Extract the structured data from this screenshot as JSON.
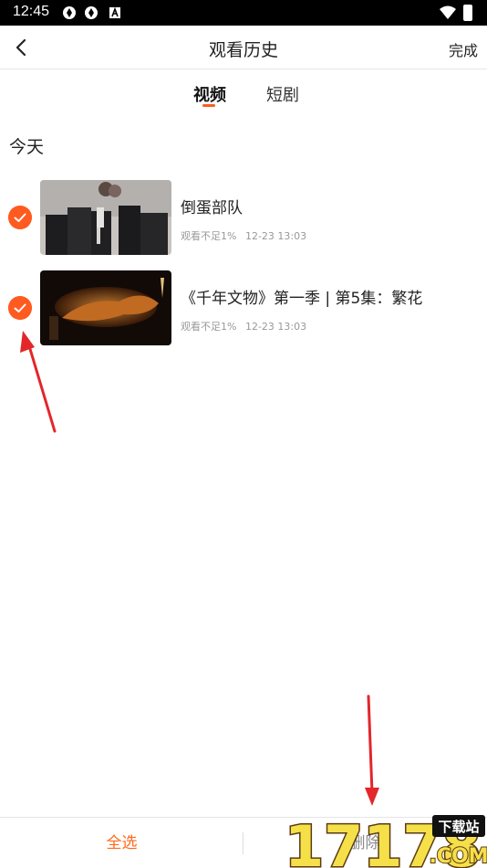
{
  "status_bar": {
    "time": "12:45",
    "icons": [
      "app-icon",
      "app-icon",
      "a-icon",
      "wifi-icon",
      "battery-icon"
    ]
  },
  "header": {
    "title": "观看历史",
    "done_label": "完成",
    "back_icon": "chevron-left-icon"
  },
  "tabs": [
    {
      "label": "视频",
      "active": true
    },
    {
      "label": "短剧",
      "active": false
    }
  ],
  "section": {
    "title": "今天"
  },
  "history_items": [
    {
      "title": "倒蛋部队",
      "progress": "观看不足1%",
      "date": "12-23 13:03",
      "checked": true
    },
    {
      "title": "《千年文物》第一季 | 第5集：繁花",
      "progress": "观看不足1%",
      "date": "12-23 13:03",
      "checked": true
    }
  ],
  "bottom_bar": {
    "select_all_label": "全选",
    "delete_label": "删除"
  },
  "watermark": {
    "number": "17178",
    "site": "下载站",
    "domain": ".COM"
  },
  "colors": {
    "accent": "#ff5a1f",
    "select_all": "#ff6a1a",
    "annotation_arrow": "#e3262a",
    "status_bar_bg": "#000000"
  }
}
